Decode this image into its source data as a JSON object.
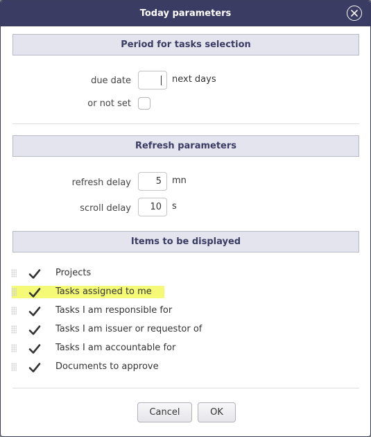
{
  "dialog": {
    "title": "Today parameters",
    "close_icon": "close-circle-icon"
  },
  "period": {
    "header": "Period for tasks selection",
    "due_date_label": "due date",
    "due_date_value": "",
    "due_date_unit": "next days",
    "not_set_label": "or not set",
    "not_set_checked": false
  },
  "refresh": {
    "header": "Refresh parameters",
    "refresh_delay_label": "refresh delay",
    "refresh_delay_value": "5",
    "refresh_delay_unit": "mn",
    "scroll_delay_label": "scroll delay",
    "scroll_delay_value": "10",
    "scroll_delay_unit": "s"
  },
  "items": {
    "header": "Items to be displayed",
    "list": [
      {
        "label": "Projects",
        "checked": true
      },
      {
        "label": "Tasks assigned to me",
        "checked": true,
        "highlighted": true
      },
      {
        "label": "Tasks I am responsible for",
        "checked": true
      },
      {
        "label": "Tasks I am issuer or requestor of",
        "checked": true
      },
      {
        "label": "Tasks I am accountable for",
        "checked": true
      },
      {
        "label": "Documents to approve",
        "checked": true
      }
    ]
  },
  "footer": {
    "cancel_label": "Cancel",
    "ok_label": "OK"
  },
  "colors": {
    "titlebar": "#3b3c63",
    "section_header_bg": "#e3e4ee",
    "highlight": "#f4f976",
    "check": "#333333"
  }
}
